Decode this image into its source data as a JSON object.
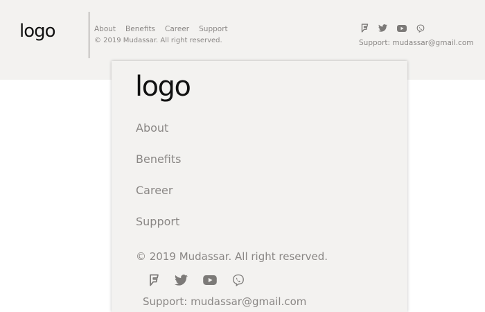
{
  "header": {
    "logo": "logo",
    "nav": [
      "About",
      "Benefits",
      "Career",
      "Support"
    ],
    "copyright": "© 2019 Mudassar. All right reserved.",
    "support": "Support: mudassar@gmail.com",
    "social_icons": [
      "foursquare-icon",
      "twitter-icon",
      "youtube-icon",
      "viber-icon"
    ]
  },
  "panel": {
    "logo": "logo",
    "nav": [
      "About",
      "Benefits",
      "Career",
      "Support"
    ],
    "copyright": "© 2019 Mudassar. All right reserved.",
    "support": "Support: mudassar@gmail.com",
    "social_icons": [
      "foursquare-icon",
      "twitter-icon",
      "youtube-icon",
      "viber-icon"
    ]
  },
  "colors": {
    "background": "#f3f2f0",
    "text": "#8a8785",
    "logo": "#111111",
    "icon": "#7c7a78"
  }
}
